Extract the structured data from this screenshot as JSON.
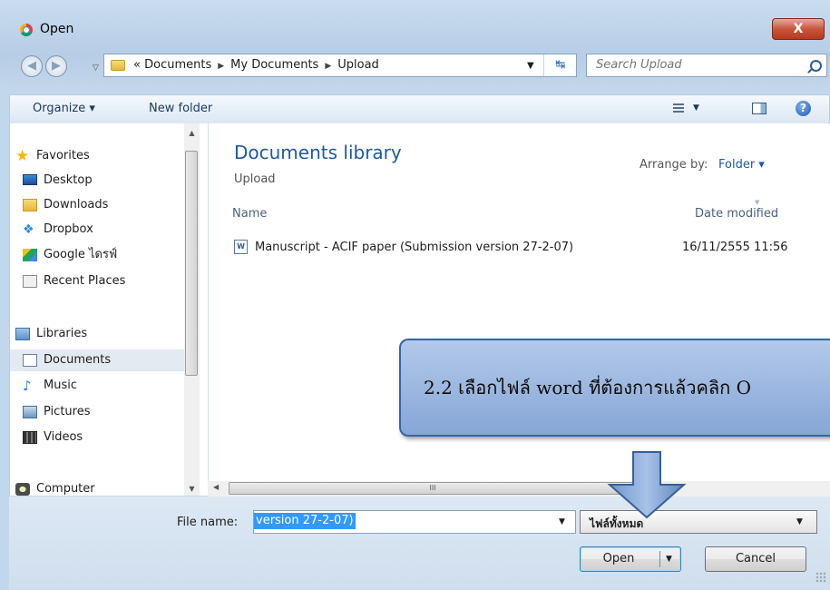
{
  "window": {
    "title": "Open",
    "close_label": "X"
  },
  "address": {
    "crumbs": [
      "«",
      "Documents",
      "My Documents",
      "Upload"
    ],
    "search_placeholder": "Search Upload"
  },
  "toolbar": {
    "organize": "Organize ▾",
    "new_folder": "New folder",
    "help": "?"
  },
  "nav": {
    "favorites_header": "Favorites",
    "favorites": [
      "Desktop",
      "Downloads",
      "Dropbox",
      "Google ไดรฟ์",
      "Recent Places"
    ],
    "libraries_header": "Libraries",
    "libraries": [
      "Documents",
      "Music",
      "Pictures",
      "Videos"
    ],
    "computer": "Computer"
  },
  "main": {
    "library_title": "Documents library",
    "library_subtitle": "Upload",
    "arrange_label": "Arrange by:",
    "arrange_value": "Folder ▾",
    "columns": {
      "name": "Name",
      "date": "Date modified"
    },
    "files": [
      {
        "name": "Manuscript - ACIF paper (Submission version 27-2-07)",
        "date": "16/11/2555 11:56",
        "icon": "word-doc-icon"
      }
    ],
    "scroll_grip": "III"
  },
  "bottom": {
    "file_name_label": "File name:",
    "file_name_value": "version 27-2-07)",
    "file_type": "ไฟล์ทั้งหมด",
    "open_label": "Open",
    "cancel_label": "Cancel"
  },
  "annotation": {
    "callout_text": "2.2 เลือกไฟล์ word ที่ต้องการแล้วคลิก O",
    "color_fill": "#8fb0dc",
    "color_border": "#3466a8"
  }
}
